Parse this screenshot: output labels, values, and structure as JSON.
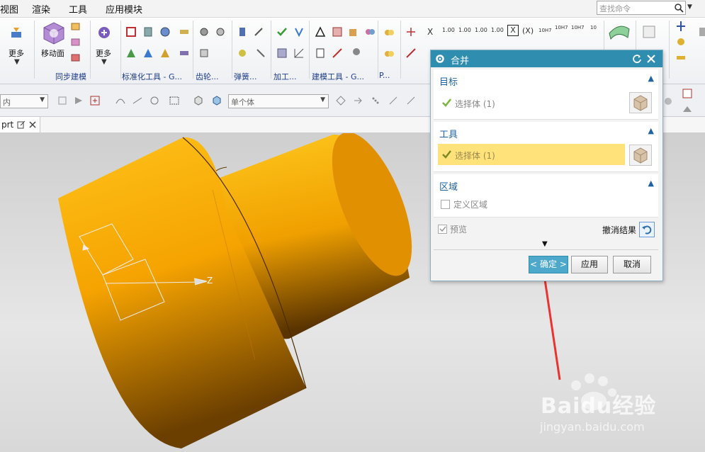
{
  "menubar": {
    "items": [
      "视图",
      "渲染",
      "工具",
      "应用模块"
    ],
    "search_placeholder": "查找命令"
  },
  "ribbon": {
    "more_label_1": "更多",
    "move_face_label": "移动面",
    "more_label_2": "更多",
    "groups": [
      "同步建模",
      "标准化工具 - G...",
      "齿轮...",
      "弹簧...",
      "加工...",
      "建模工具 - G...",
      "P..."
    ],
    "dim_labels": [
      "X",
      "1.00",
      "1.00",
      "1.00",
      "1.00",
      "(X)",
      "10H7",
      "10H7",
      "10H7",
      "10"
    ]
  },
  "toolbar2": {
    "filter_value": "内",
    "body_select_value": "单个体"
  },
  "tab": {
    "label": "prt"
  },
  "viewport": {
    "axis_label": "Z"
  },
  "dialog": {
    "title": "合并",
    "sections": {
      "target": {
        "title": "目标",
        "select_label": "选择体 (1)"
      },
      "tool": {
        "title": "工具",
        "select_label": "选择体 (1)"
      },
      "region": {
        "title": "区域",
        "define_label": "定义区域"
      }
    },
    "preview_label": "预览",
    "undo_result_label": "撤消结果",
    "ok_label": "< 确定 >",
    "apply_label": "应用",
    "cancel_label": "取消"
  },
  "watermark": {
    "brand": "Baidu经验",
    "url": "jingyan.baidu.com"
  },
  "colors": {
    "accent": "#2f8db0",
    "highlight": "#ffe27a",
    "cylinder": "#f5a300",
    "arrow": "#e8332f"
  }
}
